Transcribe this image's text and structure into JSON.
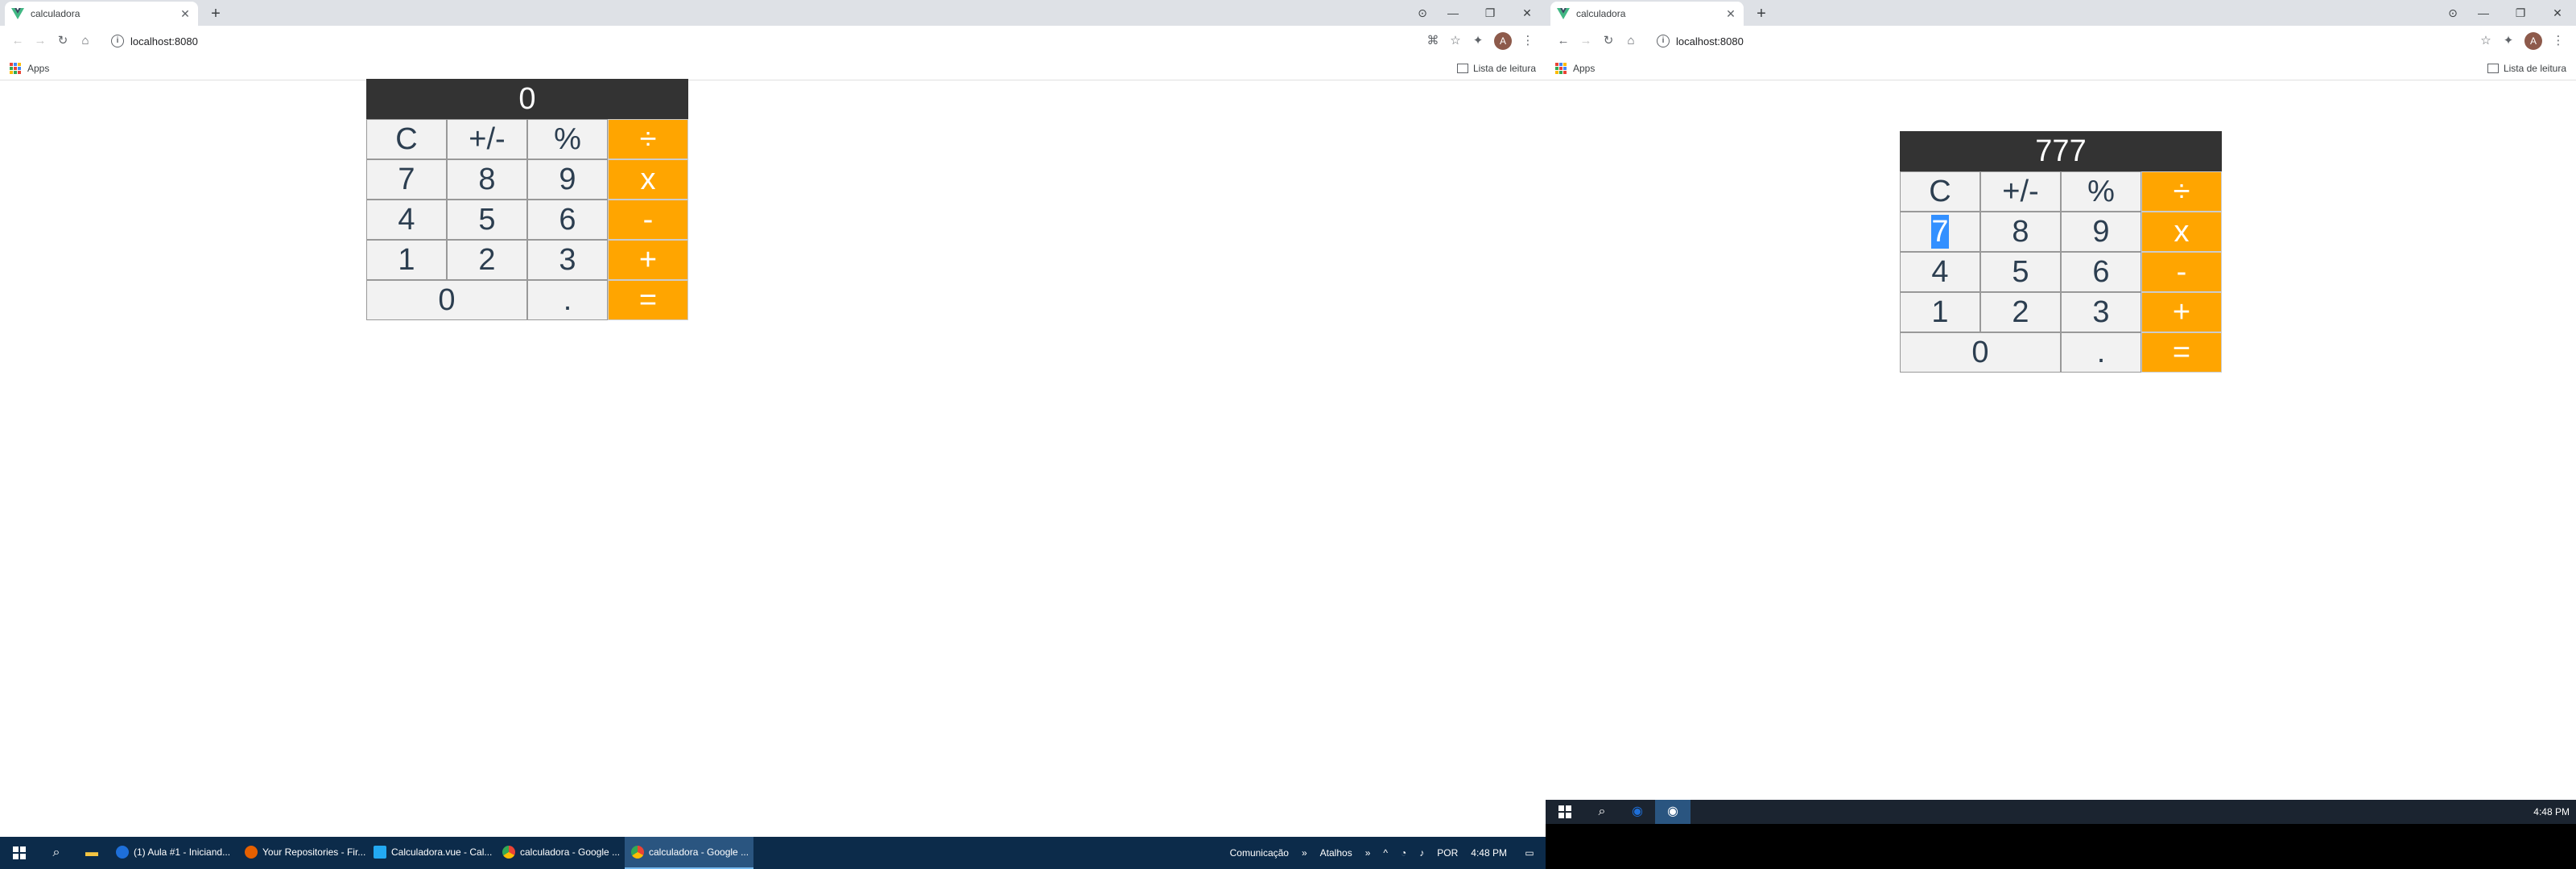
{
  "left_browser": {
    "tab_title": "calculadora",
    "url": "localhost:8080",
    "bookmark_apps": "Apps",
    "reading_list": "Lista de leitura",
    "avatar_letter": "A"
  },
  "right_browser": {
    "tab_title": "calculadora",
    "url": "localhost:8080",
    "bookmark_apps": "Apps",
    "reading_list": "Lista de leitura",
    "avatar_letter": "A"
  },
  "left_calc": {
    "display": "0",
    "keys": [
      "C",
      "+/-",
      "%",
      "÷",
      "7",
      "8",
      "9",
      "x",
      "4",
      "5",
      "6",
      "-",
      "1",
      "2",
      "3",
      "+",
      "0",
      ".",
      "="
    ]
  },
  "right_calc": {
    "display": "777",
    "keys": [
      "C",
      "+/-",
      "%",
      "÷",
      "7",
      "8",
      "9",
      "x",
      "4",
      "5",
      "6",
      "-",
      "1",
      "2",
      "3",
      "+",
      "0",
      ".",
      "="
    ]
  },
  "taskbar": {
    "apps": [
      {
        "label": "(1) Aula #1 - Iniciand...",
        "color": "#1e6fd9"
      },
      {
        "label": "Your Repositories - Fir...",
        "color": "#e66000"
      },
      {
        "label": "Calculadora.vue - Cal...",
        "color": "#23a9f2"
      },
      {
        "label": "calculadora - Google ...",
        "color": "#34a853"
      },
      {
        "label": "calculadora - Google ...",
        "color": "#34a853"
      }
    ],
    "tray_comunicacao": "Comunicação",
    "tray_atalhos": "Atalhos",
    "tray_lang": "POR",
    "time": "4:48 PM"
  },
  "secondary_taskbar": {
    "time": "4:48 PM"
  }
}
